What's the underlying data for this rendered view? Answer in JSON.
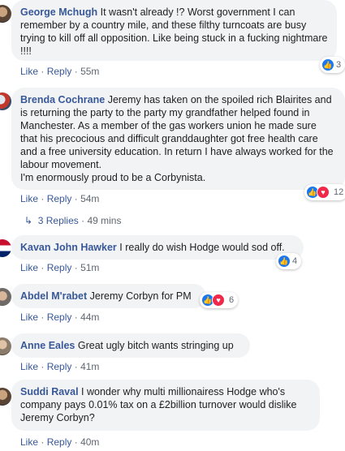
{
  "comments": [
    {
      "author": "George Mchugh",
      "text": "It wasn't already !? Worst government I can remember by a country mile, and these filthy turncoats are busy trying to kill off all opposition. Like being stuck in a fucking nightmare !!!!",
      "like": "Like",
      "reply": "Reply",
      "time": "55m",
      "reactions": [
        "like"
      ],
      "count": "3"
    },
    {
      "author": "Brenda Cochrane",
      "text": "Jeremy has taken on the spoiled rich Blairites and is returning the party to the party my grandfather helped found in Manchester. As a member of the gas workers union he made sure that his precocious and difficult granddaughter got free health care and a free university education. In return I have always worked for the labour movement.\nI'm enormously proud to be a Corbynista.",
      "like": "Like",
      "reply": "Reply",
      "time": "54m",
      "reactions": [
        "like",
        "love"
      ],
      "count": "12",
      "replies_label": "3 Replies",
      "replies_time": "49 mins"
    },
    {
      "author": "Kavan John Hawker",
      "text": "I really do wish Hodge would sod off.",
      "like": "Like",
      "reply": "Reply",
      "time": "51m",
      "reactions": [
        "like"
      ],
      "count": "4"
    },
    {
      "author": "Abdel M'rabet",
      "text": "Jeremy Corbyn for PM",
      "like": "Like",
      "reply": "Reply",
      "time": "44m",
      "reactions": [
        "like",
        "love"
      ],
      "count": "6"
    },
    {
      "author": "Anne Eales",
      "text": "Great ugly bitch wants stringing up",
      "like": "Like",
      "reply": "Reply",
      "time": "41m"
    },
    {
      "author": "Suddi Raval",
      "text": "I wonder why multi millionairess Hodge who's company pays 0.01% tax on a £2billion turnover would dislike Jeremy Corbyn?",
      "like": "Like",
      "reply": "Reply",
      "time": "40m"
    }
  ],
  "colors": {
    "link": "#385898",
    "bubble": "#f2f3f5",
    "like": "#1877f2",
    "love": "#f0284a"
  },
  "icons": {
    "like": "thumbs-up-icon",
    "love": "heart-icon",
    "reply_arrow": "reply-arrow-icon"
  }
}
